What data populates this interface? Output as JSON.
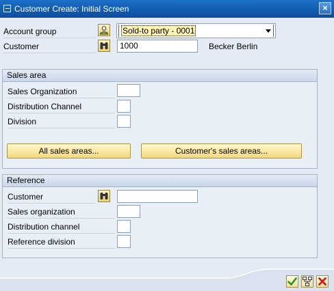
{
  "window": {
    "title": "Customer Create: Initial Screen",
    "close_symbol": "×"
  },
  "header_fields": {
    "account_group": {
      "label": "Account group",
      "value": "Sold-to party - 0001"
    },
    "customer": {
      "label": "Customer",
      "value": "1000",
      "description": "Becker Berlin"
    }
  },
  "sales_area": {
    "title": "Sales area",
    "fields": [
      {
        "label": "Sales Organization",
        "value": ""
      },
      {
        "label": "Distribution Channel",
        "value": ""
      },
      {
        "label": "Division",
        "value": ""
      }
    ],
    "buttons": {
      "all_sales_areas": "All sales areas...",
      "customers_sales_areas": "Customer's sales areas..."
    }
  },
  "reference": {
    "title": "Reference",
    "fields": [
      {
        "label": "Customer",
        "value": ""
      },
      {
        "label": "Sales organization",
        "value": ""
      },
      {
        "label": "Distribution channel",
        "value": ""
      },
      {
        "label": "Reference division",
        "value": ""
      }
    ]
  },
  "footer": {
    "buttons": [
      "check-icon",
      "tree-icon",
      "cancel-icon"
    ]
  },
  "colors": {
    "title_bar": "#1b6ec8",
    "background": "#e4ebf4",
    "button_yellow": "#f3d97c",
    "cancel_red": "#cc1f1f",
    "check_green": "#2f8f1f",
    "dropdown_focus": "#c0392b"
  }
}
